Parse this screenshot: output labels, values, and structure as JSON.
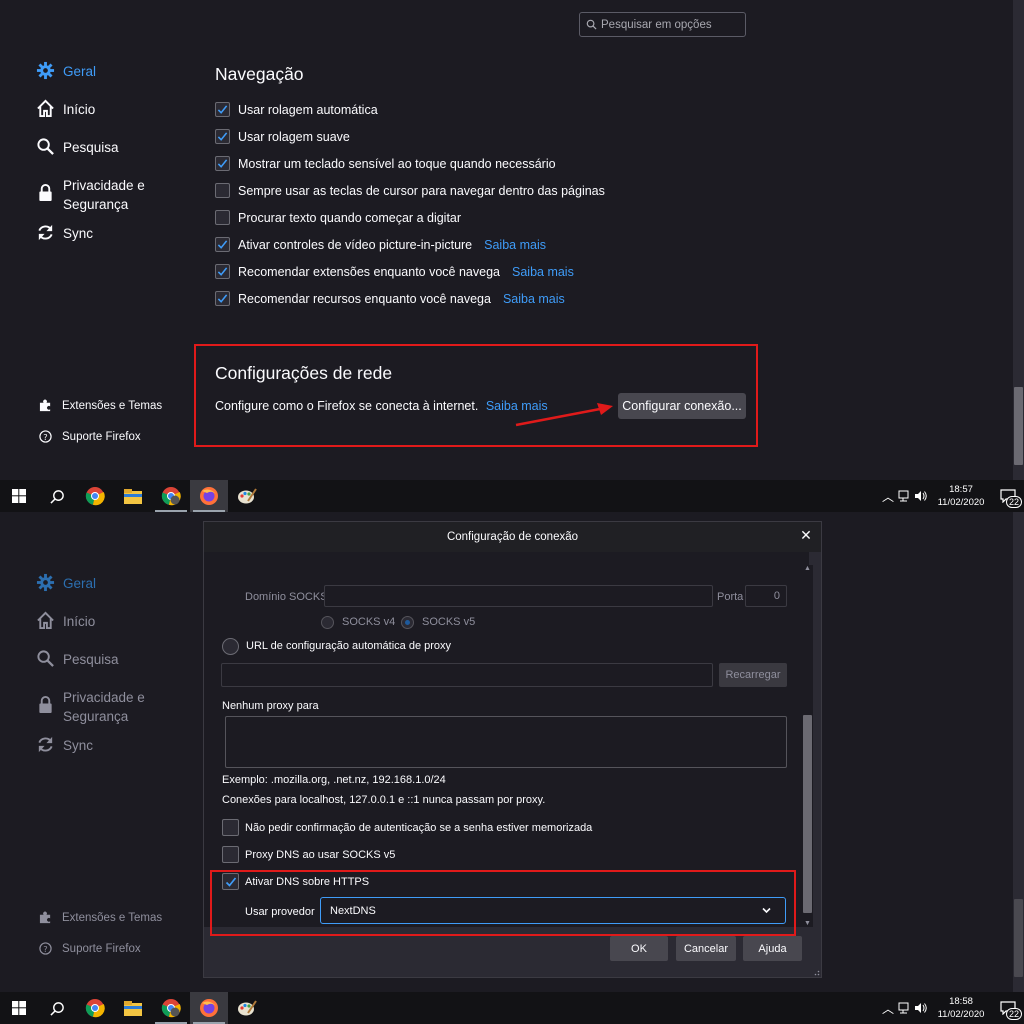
{
  "search": {
    "placeholder": "Pesquisar em opções"
  },
  "sidebar": {
    "items": [
      {
        "label": "Geral"
      },
      {
        "label": "Início"
      },
      {
        "label": "Pesquisa"
      },
      {
        "label": "Privacidade e Segurança",
        "line1": "Privacidade e",
        "line2": "Segurança"
      },
      {
        "label": "Sync"
      }
    ],
    "footer": [
      {
        "label": "Extensões e Temas"
      },
      {
        "label": "Suporte Firefox"
      }
    ]
  },
  "navigation": {
    "title": "Navegação",
    "options": [
      {
        "label": "Usar rolagem automática",
        "checked": true,
        "link": ""
      },
      {
        "label": "Usar rolagem suave",
        "checked": true,
        "link": ""
      },
      {
        "label": "Mostrar um teclado sensível ao toque quando necessário",
        "checked": true,
        "link": ""
      },
      {
        "label": "Sempre usar as teclas de cursor para navegar dentro das páginas",
        "checked": false,
        "link": ""
      },
      {
        "label": "Procurar texto quando começar a digitar",
        "checked": false,
        "link": ""
      },
      {
        "label": "Ativar controles de vídeo picture-in-picture",
        "checked": true,
        "link": "Saiba mais"
      },
      {
        "label": "Recomendar extensões enquanto você navega",
        "checked": true,
        "link": "Saiba mais"
      },
      {
        "label": "Recomendar recursos enquanto você navega",
        "checked": true,
        "link": "Saiba mais"
      }
    ]
  },
  "network": {
    "title": "Configurações de rede",
    "description": "Configure como o Firefox se conecta à internet.",
    "link": "Saiba mais",
    "button": "Configurar conexão..."
  },
  "taskbar_top": {
    "time": "18:57",
    "date": "11/02/2020",
    "notifications": "22"
  },
  "taskbar_bottom": {
    "time": "18:58",
    "date": "11/02/2020",
    "notifications": "22"
  },
  "dialog": {
    "title": "Configuração de conexão",
    "socks_domain_label": "Domínio SOCKS",
    "port_label": "Porta",
    "port_value": "0",
    "socks_v4": "SOCKS v4",
    "socks_v5": "SOCKS v5",
    "socks_version_selected": "SOCKS v5",
    "auto_proxy_label": "URL de configuração automática de proxy",
    "reload_button": "Recarregar",
    "no_proxy_label": "Nenhum proxy para",
    "example_text": "Exemplo: .mozilla.org, .net.nz, 192.168.1.0/24",
    "localhost_text": "Conexões para localhost, 127.0.0.1 e ::1 nunca passam por proxy.",
    "no_auth_prompt": {
      "label": "Não pedir confirmação de autenticação se a senha estiver memorizada",
      "checked": false
    },
    "proxy_dns": {
      "label": "Proxy DNS ao usar SOCKS v5",
      "checked": false
    },
    "doh": {
      "label": "Ativar DNS sobre HTTPS",
      "checked": true
    },
    "provider_label": "Usar provedor",
    "provider_value": "NextDNS",
    "ok_button": "OK",
    "cancel_button": "Cancelar",
    "help_button": "Ajuda"
  },
  "colors": {
    "accent": "#3f9cf8",
    "highlight_red": "#e01a1a",
    "background": "#1c1b22"
  }
}
